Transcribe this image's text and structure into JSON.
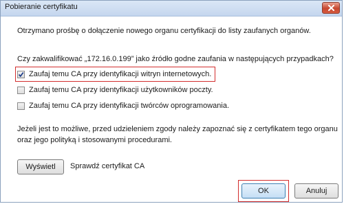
{
  "window": {
    "title": "Pobieranie certyfikatu"
  },
  "dialog": {
    "intro": "Otrzymano prośbę o dołączenie nowego organu certyfikacji do listy zaufanych organów.",
    "question": "Czy zakwalifikować „172.16.0.199” jako źródło godne zaufania w następujących przypadkach?",
    "options": [
      {
        "label": "Zaufaj temu CA przy identyfikacji witryn internetowych.",
        "checked": true
      },
      {
        "label": "Zaufaj temu CA przy identyfikacji użytkowników poczty.",
        "checked": false
      },
      {
        "label": "Zaufaj temu CA przy identyfikacji twórców oprogramowania.",
        "checked": false
      }
    ],
    "advice": "Jeżeli jest to możliwe, przed udzieleniem zgody należy zapoznać się z certyfikatem tego organu oraz jego polityką i stosowanymi procedurami.",
    "view_button": "Wyświetl",
    "view_label": "Sprawdź certyfikat CA",
    "ok_button": "OK",
    "cancel_button": "Anuluj"
  },
  "colors": {
    "highlight": "#d22c2c",
    "titlebar": "#c4d6ee"
  },
  "icons": {
    "close": "close-icon",
    "check": "checkmark-icon"
  }
}
